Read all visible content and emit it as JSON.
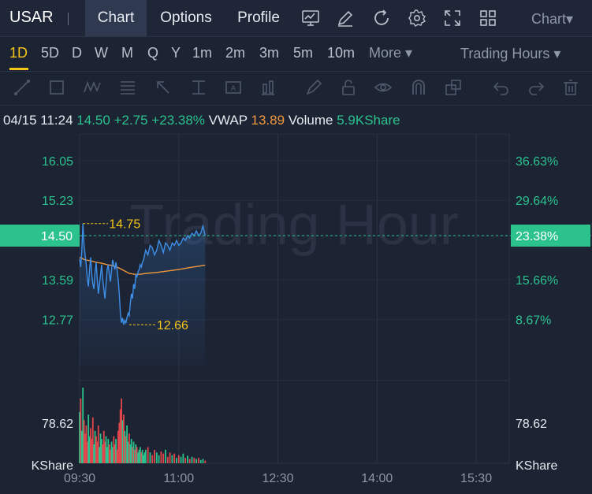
{
  "ticker": "USAR",
  "nav_tabs": [
    {
      "label": "Chart",
      "active": true
    },
    {
      "label": "Options",
      "active": false
    },
    {
      "label": "Profile",
      "active": false
    }
  ],
  "toolbar_icons": [
    "chart-display-icon",
    "drawing-pen-icon",
    "refresh-icon",
    "settings-gear-icon",
    "fullscreen-icon",
    "grid-layout-icon"
  ],
  "chart_dropdown": "Chart▾",
  "periods": [
    {
      "label": "1D",
      "active": true
    },
    {
      "label": "5D",
      "active": false
    },
    {
      "label": "D",
      "active": false
    },
    {
      "label": "W",
      "active": false
    },
    {
      "label": "M",
      "active": false
    },
    {
      "label": "Q",
      "active": false
    },
    {
      "label": "Y",
      "active": false
    },
    {
      "label": "1m",
      "active": false
    },
    {
      "label": "2m",
      "active": false
    },
    {
      "label": "3m",
      "active": false
    },
    {
      "label": "5m",
      "active": false
    },
    {
      "label": "10m",
      "active": false
    },
    {
      "label": "More ▾",
      "active": false
    }
  ],
  "session_dropdown": "Trading Hours  ▾",
  "drawing_tools": [
    "trend-line-icon",
    "rectangle-icon",
    "wave-pattern-icon",
    "fib-retracement-icon",
    "arrow-icon",
    "price-range-icon",
    "text-note-icon",
    "measure-icon",
    "brush-icon",
    "lock-icon",
    "eye-icon",
    "magnet-icon",
    "clone-icon",
    "undo-icon",
    "redo-icon",
    "trash-icon"
  ],
  "info": {
    "datetime": "04/15 11:24",
    "price": "14.50",
    "change": "+2.75",
    "change_pct": "+23.38%",
    "vwap_label": "VWAP",
    "vwap_value": "13.89",
    "volume_label": "Volume",
    "volume_value": "5.9KShare"
  },
  "colors": {
    "up": "#2bc28e",
    "down": "#e0474c",
    "price_line": "#3d8fe8",
    "vwap_line": "#f0973c",
    "highlight": "#f5c518",
    "active_tab": "#2f3a51"
  },
  "chart_data": {
    "type": "line",
    "watermark": "Trading Hour",
    "x_ticks": [
      "09:30",
      "11:00",
      "12:30",
      "14:00",
      "15:30"
    ],
    "x_range": [
      "09:30",
      "16:00"
    ],
    "price_ylim": [
      11.8,
      16.6
    ],
    "left_axis_ticks": [
      "16.05",
      "15.23",
      "14.50",
      "13.59",
      "12.77"
    ],
    "right_axis_ticks": [
      "36.63%",
      "29.64%",
      "23.38%",
      "15.66%",
      "8.67%"
    ],
    "current_price_label": "14.50",
    "current_change_label": "23.38%",
    "high": {
      "time": "09:33",
      "value": 14.75,
      "label": "14.75"
    },
    "low": {
      "time": "10:15",
      "value": 12.66,
      "label": "12.66"
    },
    "series": [
      {
        "name": "",
        "color": "#3d8fe8",
        "x": [
          "09:30",
          "09:31",
          "09:32",
          "09:33",
          "09:34",
          "09:35",
          "09:36",
          "09:37",
          "09:38",
          "09:39",
          "09:40",
          "09:41",
          "09:42",
          "09:43",
          "09:44",
          "09:45",
          "09:46",
          "09:47",
          "09:48",
          "09:49",
          "09:50",
          "09:51",
          "09:52",
          "09:53",
          "09:54",
          "09:55",
          "09:56",
          "09:57",
          "09:58",
          "09:59",
          "10:00",
          "10:01",
          "10:02",
          "10:03",
          "10:04",
          "10:05",
          "10:06",
          "10:07",
          "10:08",
          "10:09",
          "10:10",
          "10:11",
          "10:12",
          "10:13",
          "10:14",
          "10:15",
          "10:16",
          "10:17",
          "10:18",
          "10:19",
          "10:20",
          "10:21",
          "10:22",
          "10:23",
          "10:24",
          "10:25",
          "10:26",
          "10:27",
          "10:28",
          "10:29",
          "10:30",
          "10:32",
          "10:34",
          "10:36",
          "10:38",
          "10:40",
          "10:42",
          "10:44",
          "10:46",
          "10:48",
          "10:50",
          "10:52",
          "10:54",
          "10:56",
          "10:58",
          "11:00",
          "11:02",
          "11:04",
          "11:06",
          "11:08",
          "11:10",
          "11:12",
          "11:14",
          "11:16",
          "11:18",
          "11:20",
          "11:22",
          "11:24"
        ],
        "values": [
          14.02,
          13.85,
          14.2,
          14.75,
          14.3,
          14.1,
          13.9,
          13.6,
          13.45,
          13.8,
          14.05,
          13.7,
          13.5,
          13.4,
          13.75,
          13.95,
          13.6,
          13.3,
          13.5,
          13.7,
          13.9,
          13.6,
          13.4,
          13.2,
          13.5,
          13.8,
          13.9,
          13.7,
          13.55,
          13.8,
          14.0,
          13.9,
          13.8,
          13.95,
          13.8,
          13.6,
          13.3,
          12.9,
          12.7,
          12.8,
          12.66,
          12.75,
          12.7,
          12.8,
          12.9,
          12.85,
          13.1,
          13.3,
          13.2,
          13.5,
          13.4,
          13.7,
          13.65,
          13.75,
          13.8,
          13.9,
          13.85,
          13.95,
          14.0,
          14.1,
          14.2,
          14.1,
          14.3,
          14.25,
          14.1,
          14.2,
          14.4,
          14.3,
          14.15,
          14.35,
          14.3,
          14.2,
          14.35,
          14.3,
          14.4,
          14.3,
          14.35,
          14.45,
          14.4,
          14.5,
          14.45,
          14.55,
          14.5,
          14.6,
          14.5,
          14.55,
          14.7,
          14.5
        ]
      },
      {
        "name": "VWAP",
        "color": "#f0973c",
        "x": [
          "09:30",
          "09:35",
          "09:40",
          "09:45",
          "09:50",
          "09:55",
          "10:00",
          "10:05",
          "10:10",
          "10:15",
          "10:20",
          "10:25",
          "10:30",
          "10:40",
          "10:50",
          "11:00",
          "11:10",
          "11:24"
        ],
        "values": [
          14.05,
          14.0,
          13.98,
          13.95,
          13.93,
          13.9,
          13.88,
          13.84,
          13.78,
          13.72,
          13.7,
          13.7,
          13.72,
          13.74,
          13.77,
          13.8,
          13.84,
          13.89
        ]
      }
    ],
    "volume": {
      "axis_tick": "78.62",
      "axis_unit": "KShare",
      "ylim": [
        0,
        140
      ],
      "x": [
        "09:30",
        "09:31",
        "09:32",
        "09:33",
        "09:34",
        "09:35",
        "09:36",
        "09:37",
        "09:38",
        "09:39",
        "09:40",
        "09:41",
        "09:42",
        "09:43",
        "09:44",
        "09:45",
        "09:46",
        "09:47",
        "09:48",
        "09:49",
        "09:50",
        "09:51",
        "09:52",
        "09:53",
        "09:54",
        "09:55",
        "09:56",
        "09:57",
        "09:58",
        "09:59",
        "10:00",
        "10:01",
        "10:02",
        "10:03",
        "10:04",
        "10:05",
        "10:06",
        "10:07",
        "10:08",
        "10:09",
        "10:10",
        "10:11",
        "10:12",
        "10:13",
        "10:14",
        "10:15",
        "10:16",
        "10:17",
        "10:18",
        "10:19",
        "10:20",
        "10:21",
        "10:22",
        "10:23",
        "10:24",
        "10:25",
        "10:26",
        "10:27",
        "10:28",
        "10:29",
        "10:30",
        "10:32",
        "10:34",
        "10:36",
        "10:38",
        "10:40",
        "10:42",
        "10:44",
        "10:46",
        "10:48",
        "10:50",
        "10:52",
        "10:54",
        "10:56",
        "10:58",
        "11:00",
        "11:02",
        "11:04",
        "11:06",
        "11:08",
        "11:10",
        "11:12",
        "11:14",
        "11:16",
        "11:18",
        "11:20",
        "11:22",
        "11:24"
      ],
      "values": [
        95,
        120,
        60,
        140,
        80,
        55,
        70,
        40,
        90,
        50,
        65,
        45,
        85,
        35,
        60,
        50,
        40,
        70,
        30,
        55,
        45,
        35,
        60,
        40,
        50,
        30,
        45,
        35,
        25,
        40,
        30,
        50,
        35,
        45,
        25,
        60,
        75,
        100,
        120,
        80,
        90,
        60,
        50,
        70,
        40,
        55,
        35,
        45,
        30,
        40,
        25,
        35,
        30,
        20,
        25,
        30,
        20,
        25,
        15,
        20,
        25,
        30,
        20,
        15,
        25,
        20,
        15,
        22,
        18,
        25,
        12,
        20,
        15,
        18,
        10,
        15,
        12,
        18,
        10,
        14,
        8,
        12,
        10,
        8,
        10,
        6,
        8,
        5
      ],
      "up": [
        true,
        false,
        true,
        true,
        false,
        false,
        false,
        false,
        true,
        true,
        false,
        false,
        false,
        true,
        true,
        false,
        false,
        false,
        true,
        true,
        true,
        false,
        false,
        false,
        true,
        true,
        true,
        false,
        false,
        true,
        true,
        false,
        false,
        true,
        false,
        false,
        false,
        false,
        false,
        true,
        false,
        true,
        false,
        true,
        true,
        false,
        true,
        true,
        false,
        true,
        false,
        true,
        false,
        true,
        true,
        true,
        false,
        true,
        true,
        true,
        true,
        false,
        true,
        false,
        false,
        true,
        true,
        false,
        false,
        true,
        false,
        false,
        true,
        false,
        true,
        false,
        true,
        true,
        false,
        true,
        false,
        true,
        false,
        true,
        false,
        true,
        true,
        false
      ]
    }
  }
}
